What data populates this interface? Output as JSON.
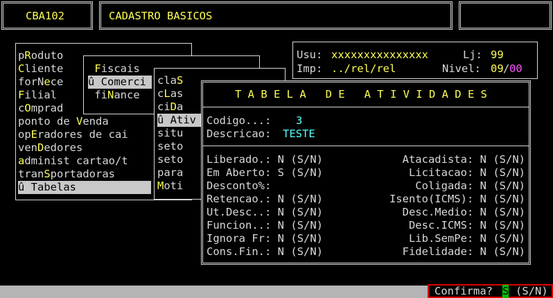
{
  "header": {
    "program_code": "CBA102",
    "title": "CADASTRO BASICOS"
  },
  "info": {
    "usu_label": "Usu:",
    "usu_value": "xxxxxxxxxxxxxxx",
    "lj_label": "Lj:",
    "lj_value": "99",
    "imp_label": "Imp:",
    "imp_value": "../rel/rel",
    "nivel_label": "Nivel:",
    "nivel_a": "09",
    "nivel_sep": "/",
    "nivel_b": "00"
  },
  "main_menu": [
    {
      "pre": "p",
      "hot": "R",
      "post": "oduto"
    },
    {
      "pre": "",
      "hot": "C",
      "post": "liente"
    },
    {
      "pre": "forN",
      "hot": "e",
      "post": "ce"
    },
    {
      "pre": "",
      "hot": "F",
      "post": "ilial"
    },
    {
      "pre": "c",
      "hot": "O",
      "post": "mprad"
    },
    {
      "pre": "ponto de ",
      "hot": "V",
      "post": "enda"
    },
    {
      "pre": "op",
      "hot": "E",
      "post": "radores de cai"
    },
    {
      "pre": "ven",
      "hot": "D",
      "post": "edores"
    },
    {
      "pre": "",
      "hot": "a",
      "post": "dminist cartao/t"
    },
    {
      "pre": "tran",
      "hot": "S",
      "post": "portadoras"
    },
    {
      "pre": "û ",
      "hot": "T",
      "post": "abelas"
    }
  ],
  "sub_menu": [
    {
      "pre": " ",
      "hot": "F",
      "post": "iscais"
    },
    {
      "pre": "û ",
      "hot": "C",
      "post": "omerci"
    },
    {
      "pre": " fi",
      "hot": "N",
      "post": "ance"
    }
  ],
  "sub_menu2": [
    {
      "pre": "cla",
      "hot": "S",
      "post": ""
    },
    {
      "pre": "c",
      "hot": "L",
      "post": "as"
    },
    {
      "pre": "ci",
      "hot": "D",
      "post": "a"
    },
    {
      "pre": "û ",
      "hot": "A",
      "post": "tiv"
    },
    {
      "pre": "situ",
      "hot": "",
      "post": ""
    },
    {
      "pre": "seto",
      "hot": "",
      "post": ""
    },
    {
      "pre": "seto",
      "hot": "",
      "post": ""
    },
    {
      "pre": "para",
      "hot": "",
      "post": ""
    },
    {
      "pre": "",
      "hot": "M",
      "post": "oti"
    }
  ],
  "dialog": {
    "title": "T A B E L A   D E   A T I V I D A D E S",
    "codigo_label": "Codigo...:",
    "codigo_value": "3",
    "descricao_label": "Descricao:",
    "descricao_value": "TESTE",
    "left_fields": [
      {
        "label": "Liberado.:",
        "value": "N",
        "hint": "(S/N)"
      },
      {
        "label": "Em Aberto:",
        "value": "S",
        "hint": "(S/N)"
      },
      {
        "label": "Desconto%:",
        "value": "",
        "hint": ""
      },
      {
        "label": "Retencao.:",
        "value": "N",
        "hint": "(S/N)"
      },
      {
        "label": "Ut.Desc..:",
        "value": "N",
        "hint": "(S/N)"
      },
      {
        "label": "Funcion..:",
        "value": "N",
        "hint": "(S/N)"
      },
      {
        "label": "Ignora Fr:",
        "value": "N",
        "hint": "(S/N)"
      },
      {
        "label": "Cons.Fin.:",
        "value": "N",
        "hint": "(S/N)"
      }
    ],
    "right_fields": [
      {
        "label": "Atacadista:",
        "value": "N",
        "hint": "(S/N)"
      },
      {
        "label": "Licitacao:",
        "value": "N",
        "hint": "(S/N)"
      },
      {
        "label": "Coligada:",
        "value": "N",
        "hint": "(S/N)"
      },
      {
        "label": "Isento(ICMS):",
        "value": "N",
        "hint": "(S/N)"
      },
      {
        "label": "Desc.Medio:",
        "value": "N",
        "hint": "(S/N)"
      },
      {
        "label": "Desc.ICMS:",
        "value": "N",
        "hint": "(S/N)"
      },
      {
        "label": "Lib.SemPe:",
        "value": "N",
        "hint": "(S/N)"
      },
      {
        "label": "Fidelidade:",
        "value": "N",
        "hint": "(S/N)"
      }
    ]
  },
  "status": {
    "confirm_label": "Confirma?",
    "confirm_value": "S",
    "confirm_hint": "(S/N)"
  },
  "colors": {
    "background": "#000000",
    "text": "#d8d8d8",
    "yellow": "#ffff55",
    "cyan": "#55ffff",
    "magenta": "#ff55ff",
    "status_bar": "#b4b4b4",
    "confirm_border": "#e00000"
  }
}
